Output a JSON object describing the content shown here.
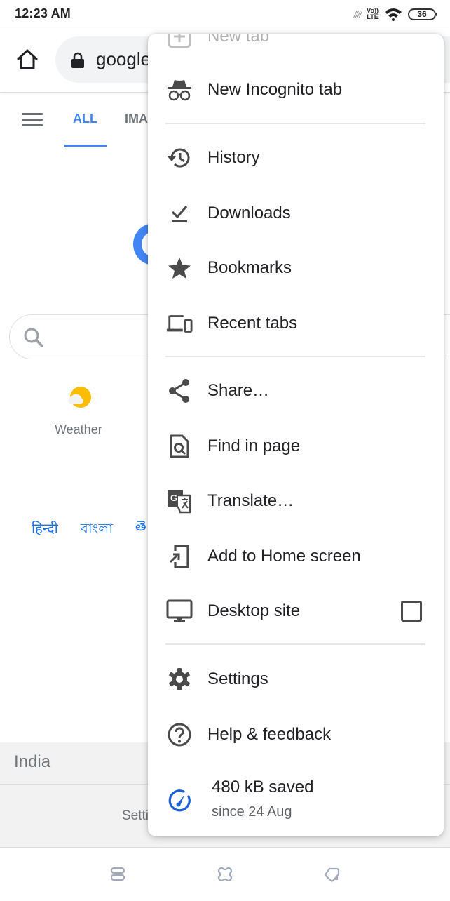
{
  "status_bar": {
    "time": "12:23 AM",
    "signal": "////",
    "volte_top": "Vo))",
    "volte_bottom": "LTE",
    "battery": "36"
  },
  "toolbar": {
    "url": "google.com"
  },
  "page": {
    "tabs": [
      {
        "label": "ALL",
        "active": true
      },
      {
        "label": "IMAGES",
        "active": false
      }
    ],
    "weather_label": "Weather",
    "languages": [
      "हिन्दी",
      "বাংলা",
      "తె"
    ],
    "footer_country": "India",
    "footer_link": "Settings"
  },
  "menu": {
    "items": [
      {
        "id": "new-tab",
        "label": "New tab",
        "icon": "new-tab-icon"
      },
      {
        "id": "new-incognito-tab",
        "label": "New Incognito tab",
        "icon": "incognito-icon"
      },
      {
        "id": "history",
        "label": "History",
        "icon": "history-icon"
      },
      {
        "id": "downloads",
        "label": "Downloads",
        "icon": "downloads-icon"
      },
      {
        "id": "bookmarks",
        "label": "Bookmarks",
        "icon": "star-icon"
      },
      {
        "id": "recent-tabs",
        "label": "Recent tabs",
        "icon": "devices-icon"
      },
      {
        "id": "share",
        "label": "Share…",
        "icon": "share-icon"
      },
      {
        "id": "find-in-page",
        "label": "Find in page",
        "icon": "find-in-page-icon"
      },
      {
        "id": "translate",
        "label": "Translate…",
        "icon": "translate-icon"
      },
      {
        "id": "add-to-home-screen",
        "label": "Add to Home screen",
        "icon": "add-to-home-icon"
      },
      {
        "id": "desktop-site",
        "label": "Desktop site",
        "icon": "desktop-icon",
        "checked": false
      },
      {
        "id": "settings",
        "label": "Settings",
        "icon": "gear-icon"
      },
      {
        "id": "help-feedback",
        "label": "Help & feedback",
        "icon": "help-icon"
      }
    ],
    "data_saver": {
      "title": "480 kB saved",
      "subtitle": "since 24 Aug"
    }
  },
  "colors": {
    "accent": "#4285f4",
    "link": "#1a73e8",
    "icon": "#4a4a4a",
    "data_saver": "#1a5fd4"
  }
}
